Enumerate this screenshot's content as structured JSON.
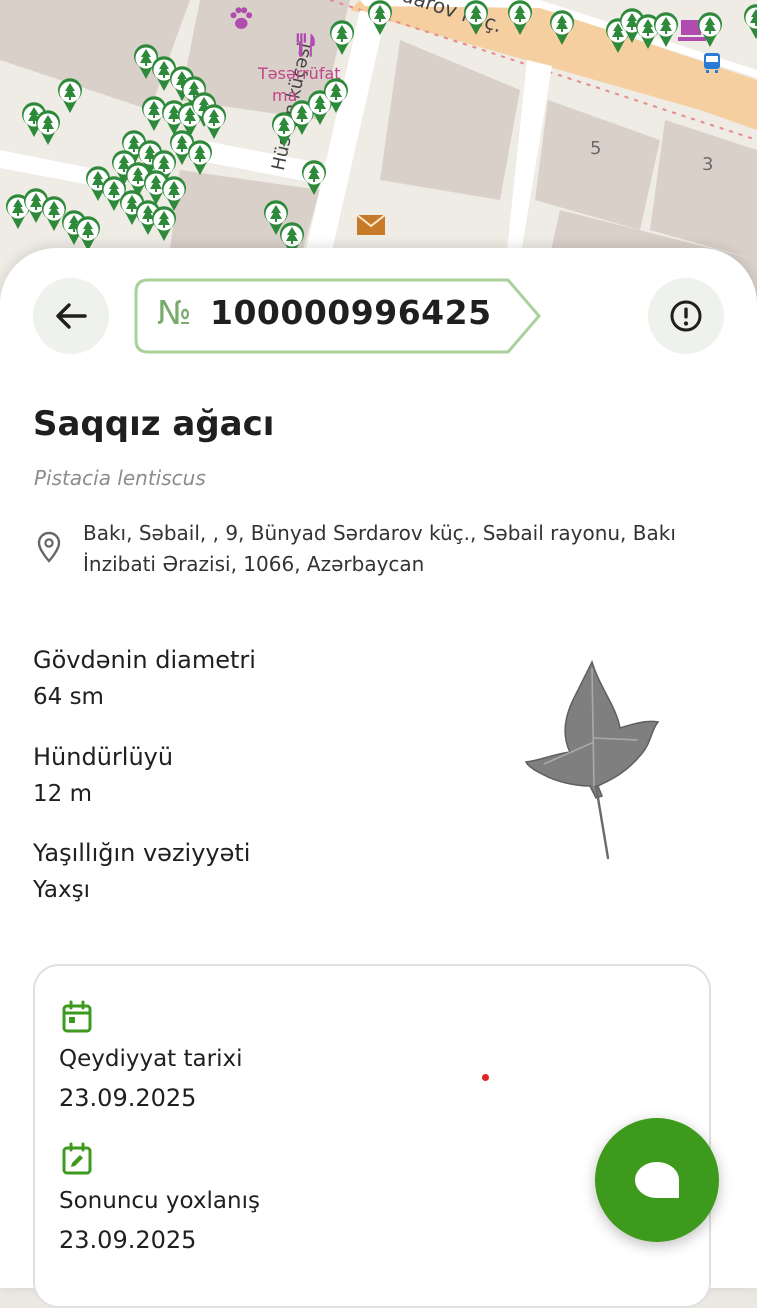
{
  "map": {
    "street_top": "darov küç.",
    "street_vertical": "Hüseyn küçəsi",
    "poi_restaurant": "Təsərrüfat",
    "poi_restaurant_line2": "ma",
    "house_5": "5",
    "house_3": "3",
    "icons": [
      "tree-marker-icon",
      "paw-icon",
      "restaurant-icon",
      "mail-icon",
      "bus-stop-icon",
      "computer-icon"
    ]
  },
  "header": {
    "back_icon": "arrow-left-icon",
    "number_prefix": "№",
    "number": "100000996425",
    "report_icon": "alert-circle-icon"
  },
  "tree": {
    "name": "Saqqız ağacı",
    "latin_name": "Pistacia lentiscus",
    "address": "Bakı, Səbail, , 9, Bünyad Sərdarov küç., Səbail rayonu, Bakı İnzibati Ərazisi, 1066, Azərbaycan",
    "leaf_icon": "leaf-image"
  },
  "properties": {
    "diameter_label": "Gövdənin diametri",
    "diameter_value": "64 sm",
    "height_label": "Hündürlüyü",
    "height_value": "12 m",
    "green_label": "Yaşıllığın vəziyyəti",
    "green_value": "Yaxşı"
  },
  "dates": {
    "registration_label": "Qeydiyyat tarixi",
    "registration_value": "23.09.2025",
    "last_check_label": "Sonuncu yoxlanış",
    "last_check_value": "23.09.2025"
  },
  "colors": {
    "accent": "#3d9a1c",
    "tag_border": "#a9d19a",
    "marker": "#2e8a3a"
  },
  "fab": {
    "icon": "chat-bubble-icon"
  }
}
